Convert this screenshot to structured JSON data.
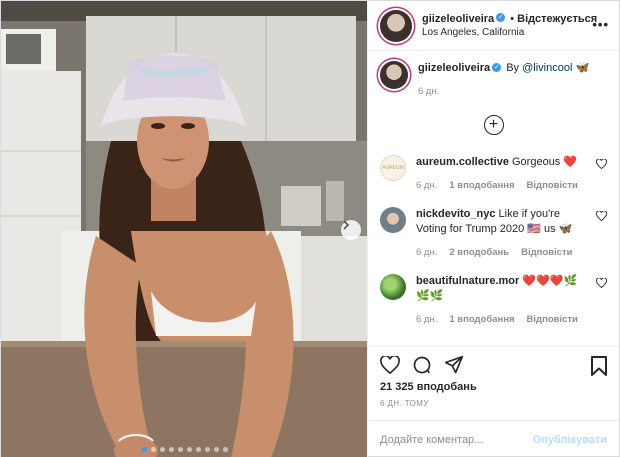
{
  "header": {
    "username": "giizeleoliveira",
    "separator": "•",
    "follow_status": "Відстежується",
    "location": "Los Angeles, California",
    "more_icon": "more-icon"
  },
  "caption": {
    "username": "giizeleoliveira",
    "text": "By",
    "mention": "@livincool",
    "emoji": "🦋",
    "time": "6 дн."
  },
  "comments": [
    {
      "username": "aureum.collective",
      "text": "Gorgeous ❤️",
      "time": "6 дн.",
      "likes": "1 вподобання",
      "reply": "Відповісти",
      "avatar_text": "AUREUM"
    },
    {
      "username": "nickdevito_nyc",
      "text": "Like if you're Voting for Trump 2020 🇺🇸 us 🦋",
      "time": "6 дн.",
      "likes": "2 вподобань",
      "reply": "Відповісти"
    },
    {
      "username": "beautifulnature.mor",
      "text": "❤️❤️❤️🌿🌿🌿",
      "time": "6 дн.",
      "likes": "1 вподобання",
      "reply": "Відповісти"
    }
  ],
  "footer": {
    "likes": "21 325 вподобань",
    "time": "6 дн. тому",
    "comment_placeholder": "Додайте коментар...",
    "publish_label": "Опублікувати"
  },
  "carousel": {
    "dot_count": 10,
    "active_index": 0
  },
  "colors": {
    "accent": "#3897f0",
    "ring": "#c13584",
    "publish_disabled": "#b2dffc",
    "heart": "#ed4956"
  }
}
